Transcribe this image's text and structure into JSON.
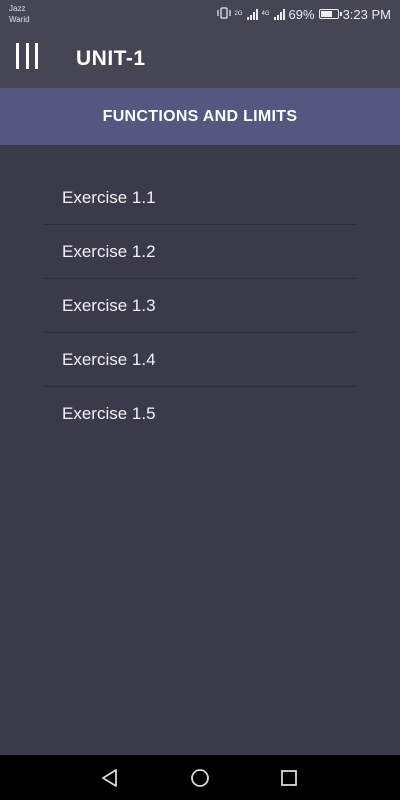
{
  "status_bar": {
    "carrier_line1": "Jazz",
    "carrier_line2": "Warid",
    "net1": "2G",
    "net2": "4G",
    "battery": "69%",
    "battery_level": 0.69,
    "time": "3:23 PM"
  },
  "toolbar": {
    "title": "UNIT-1"
  },
  "section": {
    "title": "FUNCTIONS AND LIMITS"
  },
  "exercises": [
    {
      "label": "Exercise 1.1"
    },
    {
      "label": "Exercise 1.2"
    },
    {
      "label": "Exercise 1.3"
    },
    {
      "label": "Exercise 1.4"
    },
    {
      "label": "Exercise 1.5"
    }
  ],
  "colors": {
    "background": "#3b3a4a",
    "toolbar": "#454553",
    "section_header": "#545880",
    "nav_bar": "#000000"
  }
}
